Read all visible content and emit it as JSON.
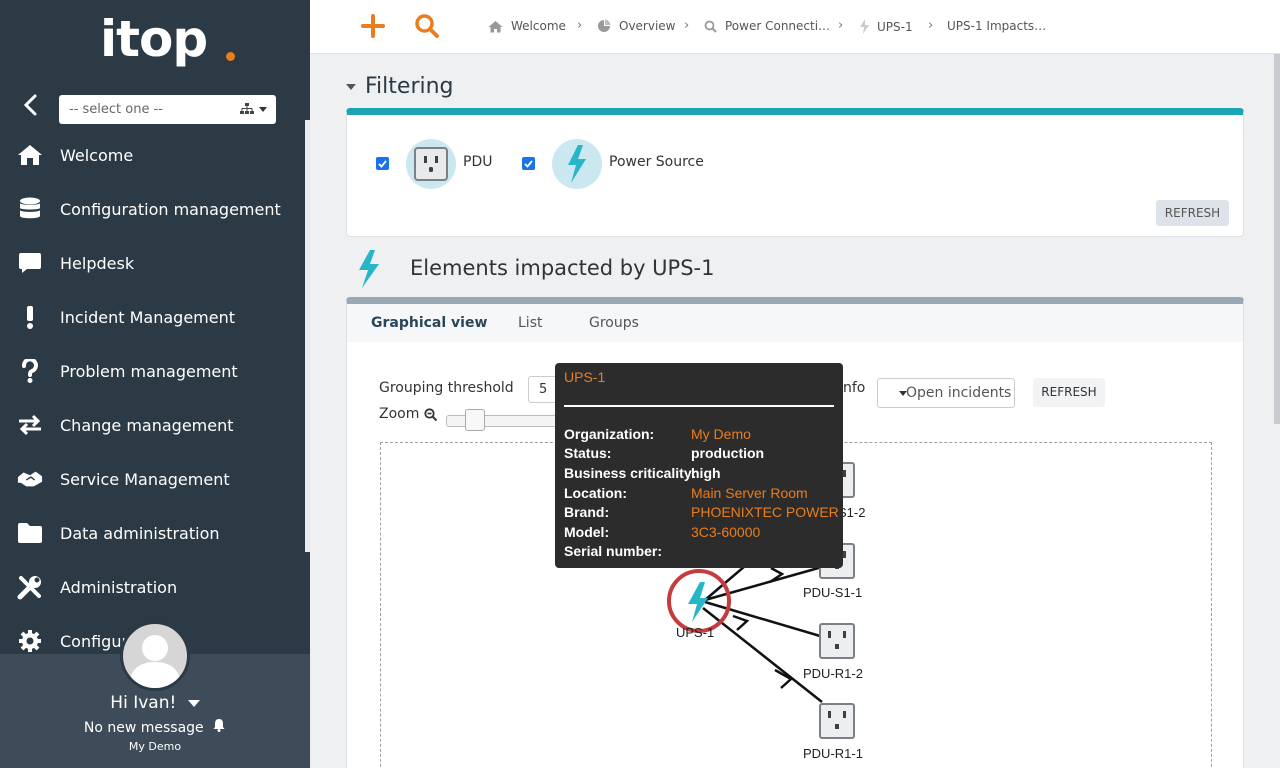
{
  "sidebar": {
    "logo": "itop",
    "org_select_placeholder": "-- select one --",
    "menu": [
      {
        "label": "Welcome",
        "icon": "home-icon"
      },
      {
        "label": "Configuration management",
        "icon": "database-icon"
      },
      {
        "label": "Helpdesk",
        "icon": "chat-icon"
      },
      {
        "label": "Incident Management",
        "icon": "exclamation-icon"
      },
      {
        "label": "Problem management",
        "icon": "question-icon"
      },
      {
        "label": "Change management",
        "icon": "exchange-icon"
      },
      {
        "label": "Service Management",
        "icon": "handshake-icon"
      },
      {
        "label": "Data administration",
        "icon": "folder-icon"
      },
      {
        "label": "Administration",
        "icon": "tools-icon"
      },
      {
        "label": "Configur",
        "icon": "gear-icon"
      }
    ],
    "user": {
      "greeting": "Hi Ivan!",
      "messages": "No new message",
      "organization": "My Demo"
    }
  },
  "topbar": {
    "breadcrumbs": [
      {
        "label": "Welcome",
        "icon": "home-icon"
      },
      {
        "label": "Overview",
        "icon": "pie-chart-icon"
      },
      {
        "label": "Power Connecti…",
        "icon": "search-icon"
      },
      {
        "label": "UPS-1",
        "icon": "bolt-icon"
      },
      {
        "label": "UPS-1 Impacts…",
        "icon": ""
      }
    ]
  },
  "filtering": {
    "title": "Filtering",
    "items": [
      {
        "label": "PDU",
        "checked": true,
        "icon": "outlet-icon"
      },
      {
        "label": "Power Source",
        "checked": true,
        "icon": "bolt-icon"
      }
    ],
    "refresh_label": "REFRESH"
  },
  "impact": {
    "title": "Elements impacted by UPS-1",
    "tabs": [
      "Graphical view",
      "List",
      "Groups"
    ],
    "active_tab": "Graphical view",
    "grouping_label": "Grouping threshold",
    "grouping_value": "5",
    "zoom_label": "Zoom",
    "info_label_fragment": "nfo",
    "info_select": "Open incidents",
    "refresh_label": "REFRESH"
  },
  "graph": {
    "nodes": [
      {
        "id": "UPS-1",
        "label": "UPS-1",
        "type": "power-source"
      },
      {
        "id": "PDU-S1-2",
        "label": "S1-2",
        "type": "pdu"
      },
      {
        "id": "PDU-S1-1",
        "label": "PDU-S1-1",
        "type": "pdu"
      },
      {
        "id": "PDU-R1-2",
        "label": "PDU-R1-2",
        "type": "pdu"
      },
      {
        "id": "PDU-R1-1",
        "label": "PDU-R1-1",
        "type": "pdu"
      }
    ]
  },
  "tooltip": {
    "title": "UPS-1",
    "rows": [
      {
        "key": "Organization:",
        "value": "My Demo",
        "link": true
      },
      {
        "key": "Status:",
        "value": "production",
        "link": false
      },
      {
        "key": "Business criticality:",
        "value": "high",
        "link": false
      },
      {
        "key": "Location:",
        "value": "Main Server Room",
        "link": true
      },
      {
        "key": "Brand:",
        "value": "PHOENIXTEC POWER",
        "link": true
      },
      {
        "key": "Model:",
        "value": "3C3-60000",
        "link": true
      },
      {
        "key": "Serial number:",
        "value": "",
        "link": false
      }
    ]
  },
  "colors": {
    "accent": "#ea7d1e",
    "sidebar": "#2b3a45",
    "teal": "#1aa4b4"
  }
}
